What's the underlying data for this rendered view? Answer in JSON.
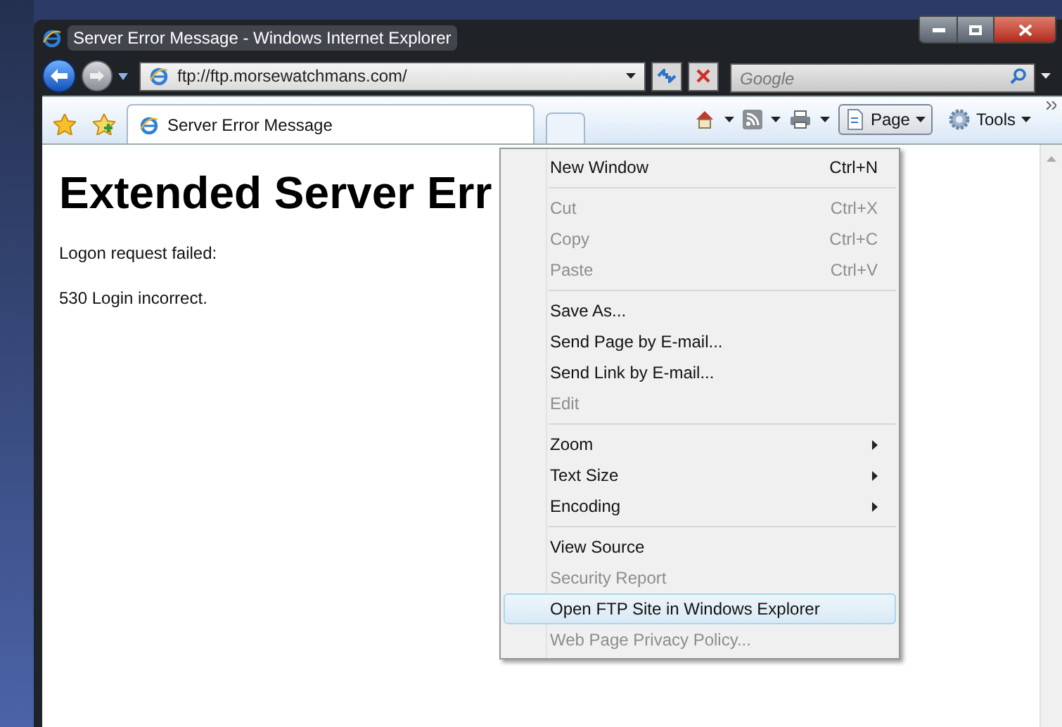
{
  "window": {
    "title": "Server Error Message - Windows Internet Explorer"
  },
  "address_bar": {
    "url": "ftp://ftp.morsewatchmans.com/"
  },
  "search": {
    "placeholder": "Google"
  },
  "tabs": [
    {
      "label": "Server Error Message",
      "selected": true
    }
  ],
  "command_bar": [
    {
      "kind": "home"
    },
    {
      "kind": "feeds"
    },
    {
      "kind": "print"
    },
    {
      "kind": "page",
      "label": "Page",
      "pressed": true
    },
    {
      "kind": "tools",
      "label": "Tools",
      "pressed": false
    }
  ],
  "page": {
    "heading": "Extended Server Err",
    "paragraphs": [
      "Logon request failed:",
      "530 Login incorrect."
    ]
  },
  "menu": {
    "groups": [
      [
        {
          "label": "New Window",
          "shortcut": "Ctrl+N",
          "disabled": false,
          "submenu": false,
          "selected": false
        }
      ],
      [
        {
          "label": "Cut",
          "shortcut": "Ctrl+X",
          "disabled": true,
          "submenu": false,
          "selected": false
        },
        {
          "label": "Copy",
          "shortcut": "Ctrl+C",
          "disabled": true,
          "submenu": false,
          "selected": false
        },
        {
          "label": "Paste",
          "shortcut": "Ctrl+V",
          "disabled": true,
          "submenu": false,
          "selected": false
        }
      ],
      [
        {
          "label": "Save As...",
          "disabled": false,
          "submenu": false,
          "selected": false
        },
        {
          "label": "Send Page by E-mail...",
          "disabled": false,
          "submenu": false,
          "selected": false
        },
        {
          "label": "Send Link by E-mail...",
          "disabled": false,
          "submenu": false,
          "selected": false
        },
        {
          "label": "Edit",
          "disabled": true,
          "submenu": false,
          "selected": false
        }
      ],
      [
        {
          "label": "Zoom",
          "disabled": false,
          "submenu": true,
          "selected": false
        },
        {
          "label": "Text Size",
          "disabled": false,
          "submenu": true,
          "selected": false
        },
        {
          "label": "Encoding",
          "disabled": false,
          "submenu": true,
          "selected": false
        }
      ],
      [
        {
          "label": "View Source",
          "disabled": false,
          "submenu": false,
          "selected": false
        },
        {
          "label": "Security Report",
          "disabled": true,
          "submenu": false,
          "selected": false
        },
        {
          "label": "Open FTP Site in Windows Explorer",
          "disabled": false,
          "submenu": false,
          "selected": true
        },
        {
          "label": "Web Page Privacy Policy...",
          "disabled": true,
          "submenu": false,
          "selected": false
        }
      ]
    ]
  }
}
